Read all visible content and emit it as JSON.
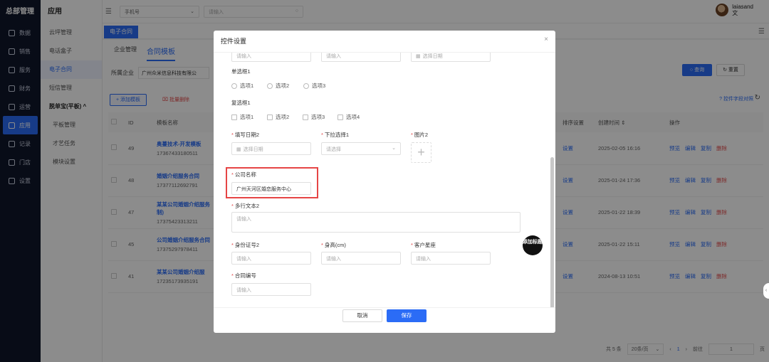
{
  "sidebar": {
    "brand": "总部管理",
    "items": [
      {
        "label": "数据",
        "icon": "monitor-icon"
      },
      {
        "label": "销售",
        "icon": "grid-icon"
      },
      {
        "label": "服务",
        "icon": "heart-icon"
      },
      {
        "label": "财务",
        "icon": "wallet-icon"
      },
      {
        "label": "运营",
        "icon": "chart-icon"
      },
      {
        "label": "应用",
        "icon": "apps-icon",
        "active": true
      },
      {
        "label": "记录",
        "icon": "file-icon"
      },
      {
        "label": "门店",
        "icon": "store-icon"
      },
      {
        "label": "设置",
        "icon": "gear-icon"
      }
    ]
  },
  "subsidebar": {
    "title": "应用",
    "items": [
      "云坪管理",
      "电话盒子",
      "电子合同",
      "短信管理",
      "脱单宝(平板) ^",
      "平板管理",
      "才艺任务",
      "模块设置"
    ]
  },
  "topbar": {
    "select_value": "手机号",
    "search_placeholder": "请输入",
    "username": "laiasand",
    "user_sub": "文"
  },
  "main": {
    "tab_active": "电子合同",
    "subtabs": [
      "企业管理",
      "合同模板"
    ],
    "filter_label": "所属企业",
    "filter_value": "广州众米信息科技有限公",
    "search_btn": "查询",
    "reset_btn": "重置",
    "add_btn": "+ 添加模板",
    "batch_delete": "批量删除",
    "field_compare": "控件字段对照",
    "columns": [
      "ID",
      "模板名称",
      "排序设置",
      "创建时间 ⇕",
      "操作"
    ],
    "rows": [
      {
        "id": "49",
        "name": "奥蔓技术-开发模板",
        "code": "17367433180511",
        "sort": "设置",
        "time": "2025-02-05 16:16"
      },
      {
        "id": "48",
        "name": "婚姻介绍服务合同",
        "code": "17377112692791",
        "sort": "设置",
        "time": "2025-01-24 17:36"
      },
      {
        "id": "47",
        "name": "某某公司婚姻介绍服务",
        "name2": "制)",
        "code": "17375423313211",
        "sort": "设置",
        "time": "2025-01-22 18:39"
      },
      {
        "id": "45",
        "name": "公司婚姻介绍服务合同",
        "code": "17375297978411",
        "sort": "设置",
        "time": "2025-01-22 15:11"
      },
      {
        "id": "41",
        "name": "某某公司婚姻介绍服",
        "code": "17235173935191",
        "sort": "设置",
        "time": "2024-08-13 10:51"
      }
    ],
    "actions": [
      "预览",
      "编辑",
      "复制",
      "删除"
    ],
    "pagination": {
      "total": "共 5 条",
      "page_size": "20条/页",
      "current": "1",
      "goto_label": "前往",
      "goto_value": "1",
      "page_unit": "页"
    }
  },
  "modal": {
    "title": "控件设置",
    "top_inputs": [
      "请输入",
      "请输入",
      "选择日期"
    ],
    "radio_label": "单选框1",
    "radio_options": [
      "选项1",
      "选项2",
      "选项3"
    ],
    "checkbox_label": "复选框1",
    "checkbox_options": [
      "选项1",
      "选项2",
      "选项3",
      "选项4"
    ],
    "date2_label": "填写日期2",
    "date2_placeholder": "选择日期",
    "select1_label": "下拉选择1",
    "select1_placeholder": "请选择",
    "image2_label": "图片2",
    "company_label": "公司名称",
    "company_value": "广州天河区婚恋服务中心",
    "text2_label": "多行文本2",
    "text2_placeholder": "请输入",
    "idcard_label": "身份证号2",
    "idcard_placeholder": "请输入",
    "height_label": "身高(cm)",
    "height_placeholder": "请输入",
    "constellation_label": "客户星座",
    "constellation_placeholder": "请输入",
    "contract_no_label": "合同编号",
    "contract_no_placeholder": "请输入",
    "add_title": "添加标题",
    "cancel": "取消",
    "save": "保存"
  },
  "colors": {
    "accent": "#2b6cf6",
    "danger": "#e34b4b",
    "sidebar": "#10162b"
  }
}
